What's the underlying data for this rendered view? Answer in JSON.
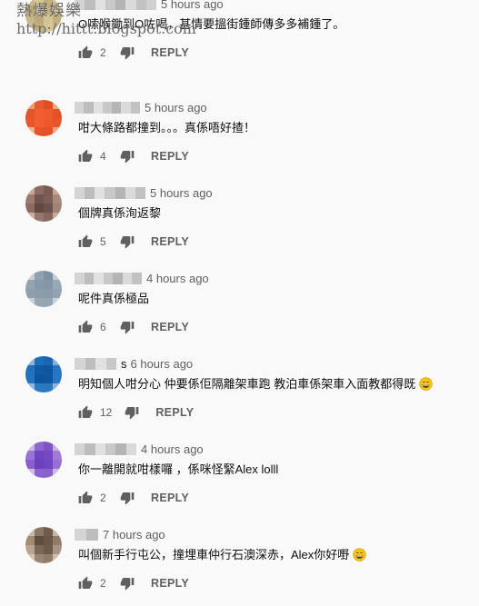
{
  "watermark": {
    "title": "熱爆娛樂",
    "url": "http://hittt.blogspot.com"
  },
  "icons": {
    "like": "thumb-up-icon",
    "dislike": "thumb-down-icon",
    "emoji": "grinning-face-icon"
  },
  "comments": [
    {
      "time": "5 hours ago",
      "text": "O嗦喉鋤到O咗喝，甚情要搵街鍾師傳多多補鍾了。",
      "likes": "2",
      "reply": "REPLY",
      "avatar_colors": [
        "#c9b98a",
        "#d6c79b",
        "#bfae7e",
        "#cfc08f",
        "#b8a676",
        "#d1c293",
        "#c2b283",
        "#d9ca9c",
        "#c6b688",
        "#bba97a",
        "#d3c496",
        "#c0af80",
        "#ccbd8e",
        "#bfae7f",
        "#d6c799",
        "#c4b486"
      ]
    },
    {
      "time": "5 hours ago",
      "text": "咁大條路都撞到。。。真係唔好揸！",
      "likes": "4",
      "reply": "REPLY",
      "avatar_colors": [
        "#f29a70",
        "#e85a2f",
        "#e24e22",
        "#f4a47c",
        "#e3542a",
        "#f05d2f",
        "#ee5b2d",
        "#e55228",
        "#e9562b",
        "#f15f31",
        "#ec5a2c",
        "#e7552a",
        "#f6b08a",
        "#e6532a",
        "#e4512a",
        "#f3a27a"
      ]
    },
    {
      "time": "5 hours ago",
      "text": "個牌真係洵返黎",
      "likes": "5",
      "reply": "REPLY",
      "avatar_colors": [
        "#c7a79a",
        "#8d6a62",
        "#7a5a54",
        "#c4a597",
        "#9b7a70",
        "#6f5550",
        "#7d5f58",
        "#a98a7f",
        "#8c6b63",
        "#60483f",
        "#6d524b",
        "#a18277",
        "#cbaea0",
        "#96776d",
        "#86675f",
        "#c6a99b"
      ]
    },
    {
      "time": "4 hours ago",
      "text": "呢件真係極品",
      "likes": "6",
      "reply": "REPLY",
      "avatar_colors": [
        "#c6ced6",
        "#8fa0ae",
        "#7e92a3",
        "#c3ccd4",
        "#93a4b2",
        "#8799aa",
        "#8496a7",
        "#98a8b5",
        "#8e9fad",
        "#8b9caa",
        "#8a9bab",
        "#92a2b0",
        "#c7cfd7",
        "#96a6b3",
        "#95a5b2",
        "#c9d1d9"
      ]
    },
    {
      "time": "6 hours ago",
      "name_suffix": "s",
      "text": "明知個人咁分心 仲要係佢隔離架車跑 教泊車係架車入面教都得既",
      "likes": "12",
      "reply": "REPLY",
      "avatar_colors": [
        "#8fb4d8",
        "#1f6fb8",
        "#1b66ad",
        "#88aed3",
        "#2272bb",
        "#0f5aa3",
        "#0d569f",
        "#2676bf",
        "#2474bd",
        "#0c559e",
        "#0e57a0",
        "#2878c1",
        "#94b8da",
        "#2a7ac2",
        "#2979c1",
        "#8fb4d8"
      ]
    },
    {
      "time": "4 hours ago",
      "text": "你一離開就咁樣囉 ，係咪怪緊Alex lolll",
      "likes": "2",
      "reply": "REPLY",
      "avatar_colors": [
        "#cbb7e6",
        "#8f66d0",
        "#7e54c6",
        "#c7b2e3",
        "#9b73d8",
        "#6f44bf",
        "#7448c2",
        "#a17ad9",
        "#8a5fcd",
        "#6c40bc",
        "#7246c0",
        "#9670d5",
        "#d0bdea",
        "#8c62ce",
        "#8961cc",
        "#ccb8e7"
      ]
    },
    {
      "time": "7 hours ago",
      "text": "叫個新手行屯公，撞埋車仲行石澳深赤，Alex你好嘢",
      "likes": "2",
      "reply": "REPLY",
      "avatar_colors": [
        "#c9b9a8",
        "#8a7766",
        "#6f5c4b",
        "#c4b4a2",
        "#a08b77",
        "#5f4d3e",
        "#6a5747",
        "#8f7b68",
        "#b8a48f",
        "#7b6755",
        "#6d5a49",
        "#a89480",
        "#d2c3b3",
        "#9a8672",
        "#907c69",
        "#cdbfae"
      ]
    }
  ]
}
